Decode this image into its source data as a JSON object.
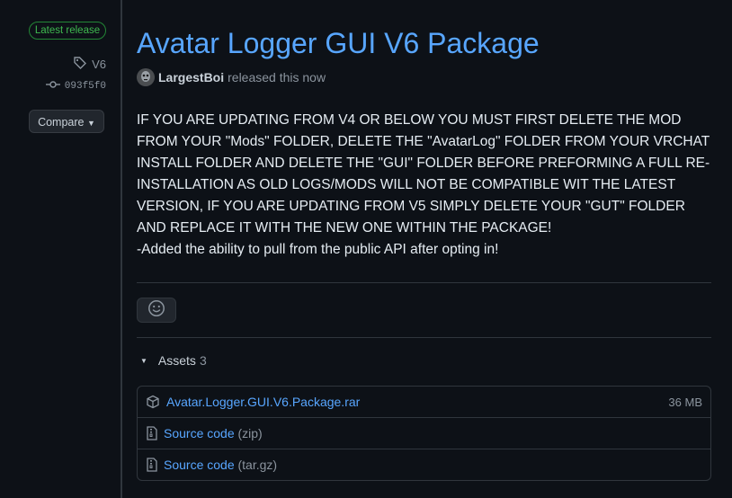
{
  "sidebar": {
    "latest_release_label": "Latest release",
    "tag": "V6",
    "commit": "093f5f0",
    "compare_label": "Compare"
  },
  "release": {
    "title": "Avatar Logger GUI V6 Package",
    "author": "LargestBoi",
    "released_text": "released this now",
    "body": [
      "IF YOU ARE UPDATING FROM V4 OR BELOW YOU MUST FIRST DELETE THE MOD FROM YOUR \"Mods\" FOLDER, DELETE THE \"AvatarLog\" FOLDER FROM YOUR VRCHAT INSTALL FOLDER AND DELETE THE \"GUI\" FOLDER BEFORE PREFORMING A FULL RE-INSTALLATION AS OLD LOGS/MODS WILL NOT BE COMPATIBLE WIT THE LATEST VERSION, IF YOU ARE UPDATING FROM V5 SIMPLY DELETE YOUR \"GUT\" FOLDER AND REPLACE IT WITH THE NEW ONE WITHIN THE PACKAGE!",
      "-Added the ability to pull from the public API after opting in!"
    ]
  },
  "assets": {
    "label": "Assets",
    "count": "3",
    "items": [
      {
        "name": "Avatar.Logger.GUI.V6.Package.rar",
        "size": "36 MB"
      },
      {
        "name": "Source code",
        "suffix": "(zip)"
      },
      {
        "name": "Source code",
        "suffix": "(tar.gz)"
      }
    ]
  },
  "colors": {
    "background": "#0d1117",
    "link": "#58a6ff",
    "badge_green": "#3fb950",
    "border": "#30363d"
  }
}
